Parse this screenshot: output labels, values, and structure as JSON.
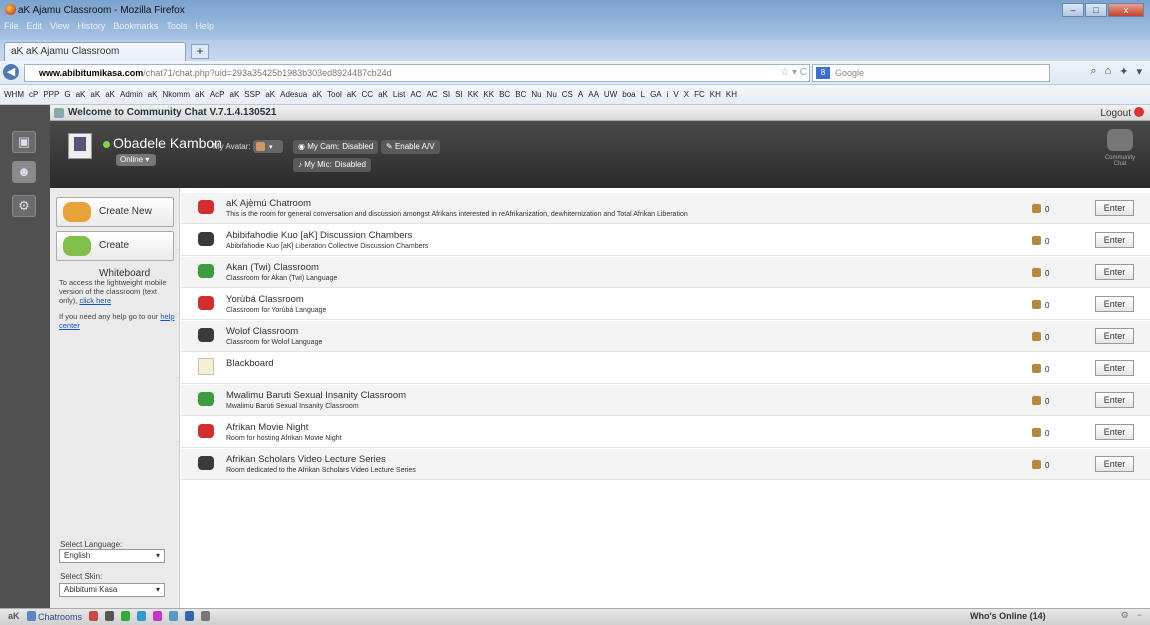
{
  "window": {
    "title": "aK Ajamu Classroom - Mozilla Firefox",
    "menu": [
      "File",
      "Edit",
      "View",
      "History",
      "Bookmarks",
      "Tools",
      "Help"
    ],
    "buttons": {
      "min": "–",
      "max": "□",
      "close": "x"
    }
  },
  "tab": {
    "label": "aK aK Ajamu Classroom",
    "new_tab": "+"
  },
  "navigation": {
    "url_host": "www.abibitumikasa.com",
    "url_path": "/chat71/chat.php?uid=293a35425b1983b303ed8924487cb24d",
    "search_placeholder": "Google"
  },
  "bookmarks": [
    "WHM",
    "cP",
    "PPP",
    "G",
    "aK",
    "aK",
    "aK",
    "Admin",
    "aK",
    "Nkomm",
    "aK",
    "AcP",
    "aK",
    "SSP",
    "aK",
    "Adesua",
    "aK",
    "Tool",
    "aK",
    "CC",
    "aK",
    "List",
    "AC",
    "AC",
    "SI",
    "SI",
    "KK",
    "KK",
    "BC",
    "BC",
    "Nu",
    "Nu",
    "CS",
    "A",
    "AA",
    "UW",
    "boa",
    "L",
    "GA",
    "i",
    "V",
    "X",
    "FC",
    "KH",
    "KH"
  ],
  "app": {
    "title": "Welcome to Community Chat V.7.1.4.130521",
    "logout": "Logout",
    "logo_label": "Community Chat",
    "user": {
      "name": "Obadele Kambon",
      "status": "Online ▾",
      "my_avatar": "My Avatar:",
      "my_cam": "My Cam:",
      "cam_state": "Disabled",
      "enable_av": "Enable A/V",
      "my_mic": "My Mic:",
      "mic_state": "Disabled"
    },
    "sidebar": {
      "create_room": "Create New Room",
      "create_whiteboard": "Create Whiteboard",
      "mobile_text": "To access the lightweight mobile version of the classroom (text only),",
      "mobile_link": "click here",
      "help_text": "If you need any help go to our",
      "help_link": "help center",
      "language_label": "Select Language:",
      "language_value": "English",
      "skin_label": "Select Skin:",
      "skin_value": "Abibitumi Kasa"
    },
    "rooms": [
      {
        "name": "aK Ajẹ̀mú Chatroom",
        "desc": "This is the room for general conversation and discussion amongst Afrikans interested in reAfrikanization, dewhiternization and Total Afrikan Liberation",
        "count": "0",
        "enter": "Enter",
        "icon": "red"
      },
      {
        "name": "Abibifahodie Kuo [aK] Discussion Chambers",
        "desc": "Abibifahodie Kuo [aK] Liberation Collective Discussion Chambers",
        "count": "0",
        "enter": "Enter",
        "icon": "dark"
      },
      {
        "name": "Akan (Twi) Classroom",
        "desc": "Classroom for Akan (Twi) Language",
        "count": "0",
        "enter": "Enter",
        "icon": "green"
      },
      {
        "name": "Yorùbá Classroom",
        "desc": "Classroom for Yorùbá Language",
        "count": "0",
        "enter": "Enter",
        "icon": "red"
      },
      {
        "name": "Wolof Classroom",
        "desc": "Classroom for Wolof Language",
        "count": "0",
        "enter": "Enter",
        "icon": "dark"
      },
      {
        "name": "Blackboard",
        "desc": "",
        "count": "0",
        "enter": "Enter",
        "icon": "board"
      },
      {
        "name": "Mwalimu Baruti Sexual Insanity Classroom",
        "desc": "Mwalimu Baruti Sexual Insanity Classroom",
        "count": "0",
        "enter": "Enter",
        "icon": "green"
      },
      {
        "name": "Afrikan Movie Night",
        "desc": "Room for hosting Afrikan Movie Night",
        "count": "0",
        "enter": "Enter",
        "icon": "red"
      },
      {
        "name": "Afrikan Scholars Video Lecture Series",
        "desc": "Room dedicated to the Afrikan Scholars Video Lecture Series",
        "count": "0",
        "enter": "Enter",
        "icon": "dark"
      }
    ],
    "bottombar": {
      "brand": "aK",
      "chatrooms": "Chatrooms",
      "whos_online": "Who's Online (14)"
    }
  }
}
